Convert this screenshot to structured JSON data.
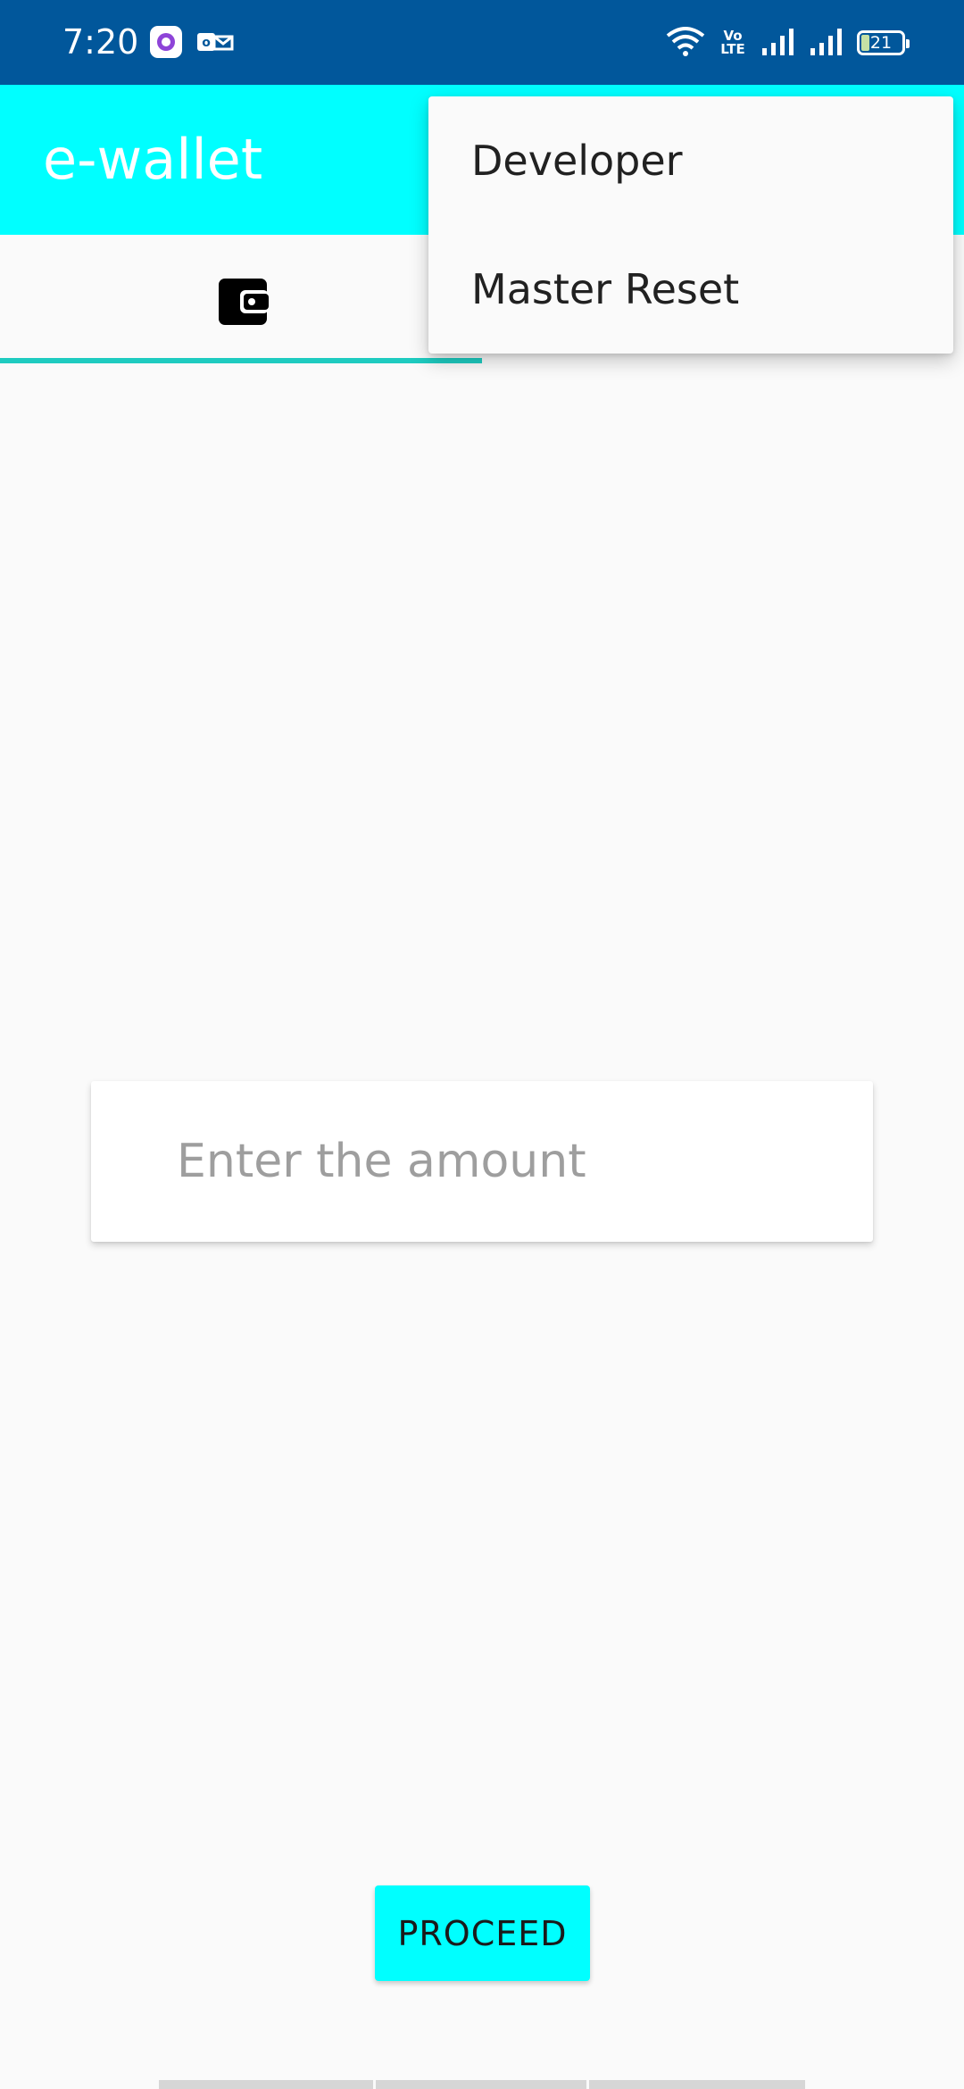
{
  "status_bar": {
    "time": "7:20",
    "network": "Vo LTE",
    "battery": "21"
  },
  "app_bar": {
    "title": "e-wallet"
  },
  "tabs": [
    {
      "icon": "wallet-icon",
      "selected": true
    }
  ],
  "overflow_menu": {
    "items": [
      {
        "label": "Developer"
      },
      {
        "label": "Master Reset"
      }
    ]
  },
  "amount_field": {
    "value": "",
    "placeholder": "Enter the amount"
  },
  "proceed_button": {
    "label": "PROCEED"
  },
  "colors": {
    "status_bar": "#01579b",
    "app_bar": "#00ffff",
    "tab_indicator": "#1ecbc0",
    "button": "#00ffff",
    "background": "#fafafa"
  }
}
